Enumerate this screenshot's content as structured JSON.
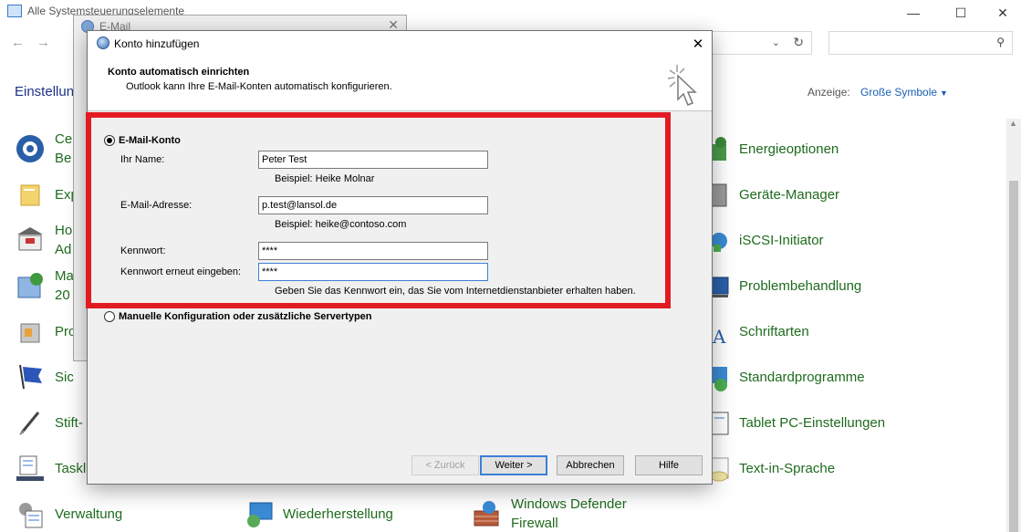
{
  "control_panel": {
    "title": "Alle Systemsteuerungselemente",
    "heading": "Einstellun",
    "view_label": "Anzeige:",
    "view_value": "Große Symbole",
    "refresh_icon": "refresh-icon",
    "search_icon": "search-icon",
    "items_left": [
      {
        "label": "Ce\nBe",
        "icon": "sync-center-icon"
      },
      {
        "label": "Exp",
        "icon": "file-explorer-icon"
      },
      {
        "label": "Ho\nAd",
        "icon": "bank-icon"
      },
      {
        "label": "Ma\n20",
        "icon": "mail-icon"
      },
      {
        "label": "Pro",
        "icon": "programs-icon"
      },
      {
        "label": "Sic",
        "icon": "flag-icon"
      },
      {
        "label": "Stift-",
        "icon": "pen-icon"
      },
      {
        "label": "Taskl",
        "icon": "taskbar-icon"
      },
      {
        "label": "Verwaltung",
        "icon": "admin-tools-icon"
      }
    ],
    "items_middle": [
      {
        "label": "Wiederherstellung",
        "icon": "recovery-icon"
      }
    ],
    "items_third": [
      {
        "label": "Windows Defender\nFirewall",
        "icon": "firewall-icon"
      }
    ],
    "items_right": [
      {
        "label": "Energieoptionen",
        "icon": "power-icon"
      },
      {
        "label": "Geräte-Manager",
        "icon": "device-manager-icon"
      },
      {
        "label": "iSCSI-Initiator",
        "icon": "iscsi-icon"
      },
      {
        "label": "Problembehandlung",
        "icon": "troubleshoot-icon"
      },
      {
        "label": "Schriftarten",
        "icon": "fonts-icon"
      },
      {
        "label": "Standardprogramme",
        "icon": "default-programs-icon"
      },
      {
        "label": "Tablet PC-Einstellungen",
        "icon": "tablet-icon"
      },
      {
        "label": "Text-in-Sprache",
        "icon": "speech-icon"
      }
    ]
  },
  "mail_dialog": {
    "title": "E-Mail"
  },
  "account_dialog": {
    "title": "Konto hinzufügen",
    "header_title": "Konto automatisch einrichten",
    "header_subtitle": "Outlook kann Ihre E-Mail-Konten automatisch konfigurieren.",
    "option_email": "E-Mail-Konto",
    "option_manual": "Manuelle Konfiguration oder zusätzliche Servertypen",
    "name_label": "Ihr Name:",
    "name_value": "Peter Test",
    "name_hint": "Beispiel: Heike Molnar",
    "email_label": "E-Mail-Adresse:",
    "email_value": "p.test@lansol.de",
    "email_hint": "Beispiel: heike@contoso.com",
    "password_label": "Kennwort:",
    "password_value": "****",
    "password_repeat_label": "Kennwort erneut eingeben:",
    "password_repeat_value": "****",
    "password_hint": "Geben Sie das Kennwort ein, das Sie vom Internetdienstanbieter erhalten haben.",
    "buttons": {
      "back": "< Zurück",
      "next": "Weiter >",
      "cancel": "Abbrechen",
      "help": "Hilfe"
    }
  },
  "colors": {
    "highlight_frame": "#e21b23",
    "link_blue": "#1a5fb4",
    "item_green": "#1e6b1e"
  }
}
